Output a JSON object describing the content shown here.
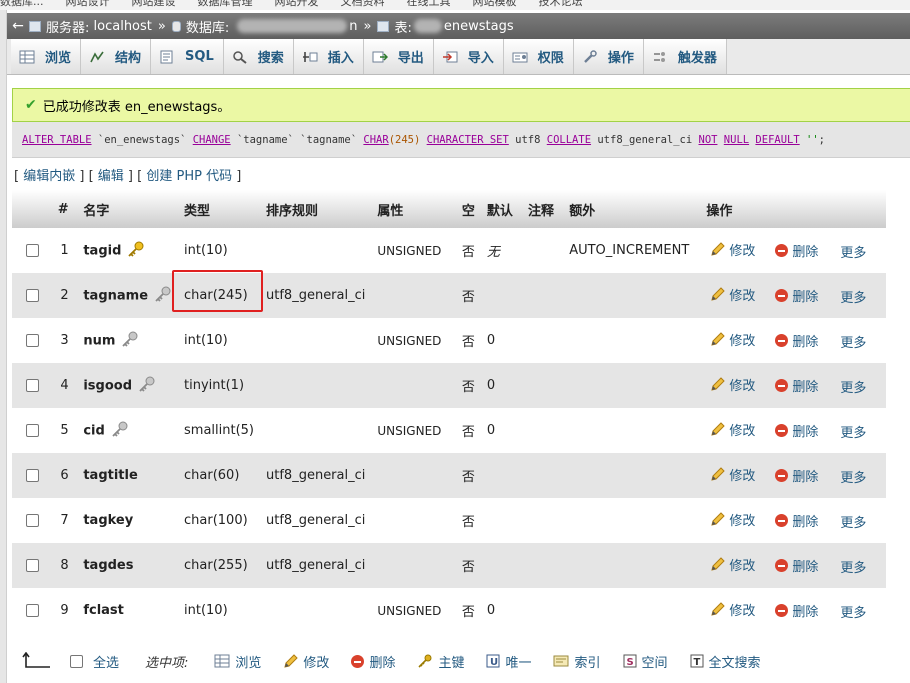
{
  "bookmarks": [
    "数据库...",
    "网站设计",
    "网站建设",
    "数据库管理",
    "网站开发",
    "文档资料",
    "在线工具",
    "网站模板",
    "技术论坛"
  ],
  "breadcrumb": {
    "server_label": "服务器:",
    "server_value": "localhost",
    "db_label": "数据库:",
    "db_value_tail": "n",
    "table_label": "表:",
    "table_value": "enewstags",
    "separator": "»"
  },
  "tabs": [
    {
      "label": "浏览",
      "icon": "browse-icon"
    },
    {
      "label": "结构",
      "icon": "structure-icon"
    },
    {
      "label": "SQL",
      "icon": "sql-icon"
    },
    {
      "label": "搜索",
      "icon": "search-icon"
    },
    {
      "label": "插入",
      "icon": "insert-icon"
    },
    {
      "label": "导出",
      "icon": "export-icon"
    },
    {
      "label": "导入",
      "icon": "import-icon"
    },
    {
      "label": "权限",
      "icon": "privileges-icon"
    },
    {
      "label": "操作",
      "icon": "operations-icon"
    },
    {
      "label": "触发器",
      "icon": "triggers-icon"
    }
  ],
  "message": {
    "text": "已成功修改表 en_enewstags。",
    "color": "#ebf8a4"
  },
  "sql_query": {
    "parts": [
      {
        "t": "ALTER TABLE",
        "c": "kw"
      },
      {
        "t": " `en_enewstags` ",
        "c": ""
      },
      {
        "t": "CHANGE",
        "c": "kw"
      },
      {
        "t": " `tagname` `tagname` ",
        "c": ""
      },
      {
        "t": "CHAR",
        "c": "kw"
      },
      {
        "t": "(245) ",
        "c": "num"
      },
      {
        "t": "CHARACTER SET",
        "c": "kw"
      },
      {
        "t": " utf8 ",
        "c": ""
      },
      {
        "t": "COLLATE",
        "c": "kw"
      },
      {
        "t": " utf8_general_ci ",
        "c": ""
      },
      {
        "t": "NOT",
        "c": "kw"
      },
      {
        "t": " ",
        "c": ""
      },
      {
        "t": "NULL",
        "c": "kw"
      },
      {
        "t": " ",
        "c": ""
      },
      {
        "t": "DEFAULT",
        "c": "kw"
      },
      {
        "t": " ''",
        "c": "str"
      },
      {
        "t": ";",
        "c": ""
      }
    ]
  },
  "query_links": {
    "edit_inline": "编辑内嵌",
    "edit": "编辑",
    "create_php": "创建 PHP 代码"
  },
  "table": {
    "headers": [
      "#",
      "名字",
      "类型",
      "排序规则",
      "属性",
      "空",
      "默认",
      "注释",
      "额外",
      "操作"
    ],
    "rows": [
      {
        "num": "1",
        "name": "tagid",
        "key": "primary",
        "type": "int(10)",
        "collation": "",
        "attributes": "UNSIGNED",
        "null": "否",
        "default": "无",
        "comment": "",
        "extra": "AUTO_INCREMENT"
      },
      {
        "num": "2",
        "name": "tagname",
        "key": "index",
        "type": "char(245)",
        "collation": "utf8_general_ci",
        "attributes": "",
        "null": "否",
        "default": "",
        "comment": "",
        "extra": ""
      },
      {
        "num": "3",
        "name": "num",
        "key": "index",
        "type": "int(10)",
        "collation": "",
        "attributes": "UNSIGNED",
        "null": "否",
        "default": "0",
        "comment": "",
        "extra": ""
      },
      {
        "num": "4",
        "name": "isgood",
        "key": "index",
        "type": "tinyint(1)",
        "collation": "",
        "attributes": "",
        "null": "否",
        "default": "0",
        "comment": "",
        "extra": ""
      },
      {
        "num": "5",
        "name": "cid",
        "key": "index",
        "type": "smallint(5)",
        "collation": "",
        "attributes": "UNSIGNED",
        "null": "否",
        "default": "0",
        "comment": "",
        "extra": ""
      },
      {
        "num": "6",
        "name": "tagtitle",
        "key": "",
        "type": "char(60)",
        "collation": "utf8_general_ci",
        "attributes": "",
        "null": "否",
        "default": "",
        "comment": "",
        "extra": ""
      },
      {
        "num": "7",
        "name": "tagkey",
        "key": "",
        "type": "char(100)",
        "collation": "utf8_general_ci",
        "attributes": "",
        "null": "否",
        "default": "",
        "comment": "",
        "extra": ""
      },
      {
        "num": "8",
        "name": "tagdes",
        "key": "",
        "type": "char(255)",
        "collation": "utf8_general_ci",
        "attributes": "",
        "null": "否",
        "default": "",
        "comment": "",
        "extra": ""
      },
      {
        "num": "9",
        "name": "fclast",
        "key": "",
        "type": "int(10)",
        "collation": "",
        "attributes": "UNSIGNED",
        "null": "否",
        "default": "0",
        "comment": "",
        "extra": ""
      }
    ],
    "actions": {
      "edit": "修改",
      "drop": "删除",
      "more": "更多"
    }
  },
  "bottom_bar": {
    "check_all": "全选",
    "with_selected": "选中项:",
    "items": [
      {
        "label": "浏览",
        "icon": "browse-icon"
      },
      {
        "label": "修改",
        "icon": "pencil-icon"
      },
      {
        "label": "删除",
        "icon": "drop-icon"
      },
      {
        "label": "主键",
        "icon": "primary-key-icon"
      },
      {
        "label": "唯一",
        "icon": "unique-icon"
      },
      {
        "label": "索引",
        "icon": "index-icon"
      },
      {
        "label": "空间",
        "icon": "spatial-icon"
      },
      {
        "label": "全文搜索",
        "icon": "fulltext-icon"
      }
    ]
  },
  "colors": {
    "link": "#235a81",
    "highlight_box": "#e02020",
    "row_alt": "#e5e5e5"
  }
}
